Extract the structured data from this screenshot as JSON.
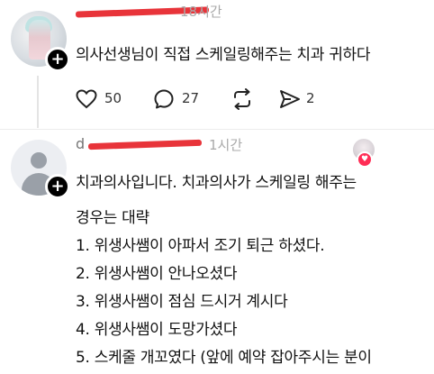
{
  "post1": {
    "username_redacted": "redacted username",
    "time_faded": "18시간",
    "text": "의사선생님이 직접 스케일링해주는 치과 귀하다",
    "actions": {
      "like_count": "50",
      "reply_count": "27",
      "repost_count": "",
      "share_count": "2"
    }
  },
  "post2": {
    "username_prefix": "d",
    "username_redacted": "redacted username",
    "time_faded": "1시간",
    "lines": [
      "치과의사입니다. 치과의사가 스케일링 해주는",
      "경우는 대략",
      "1. 위생사쌤이 아파서 조기 퇴근 하셨다.",
      "2. 위생사쌤이 안나오셨다",
      "3. 위생사쌤이 점심 드시거 계시다",
      "4. 위생사쌤이 도망가셨다",
      "5. 스케줄 개꼬였다 (앞에 예약 잡아주시는 분이"
    ]
  },
  "icons": {
    "like": "heart-icon",
    "reply": "comment-icon",
    "repost": "repost-icon",
    "share": "send-icon",
    "follow": "plus-icon",
    "liked_by": "heart-badge-icon"
  },
  "colors": {
    "redaction": "#e8343a",
    "heart_badge": "#ff2d55",
    "text": "#111111",
    "muted": "#a9a9a9"
  }
}
